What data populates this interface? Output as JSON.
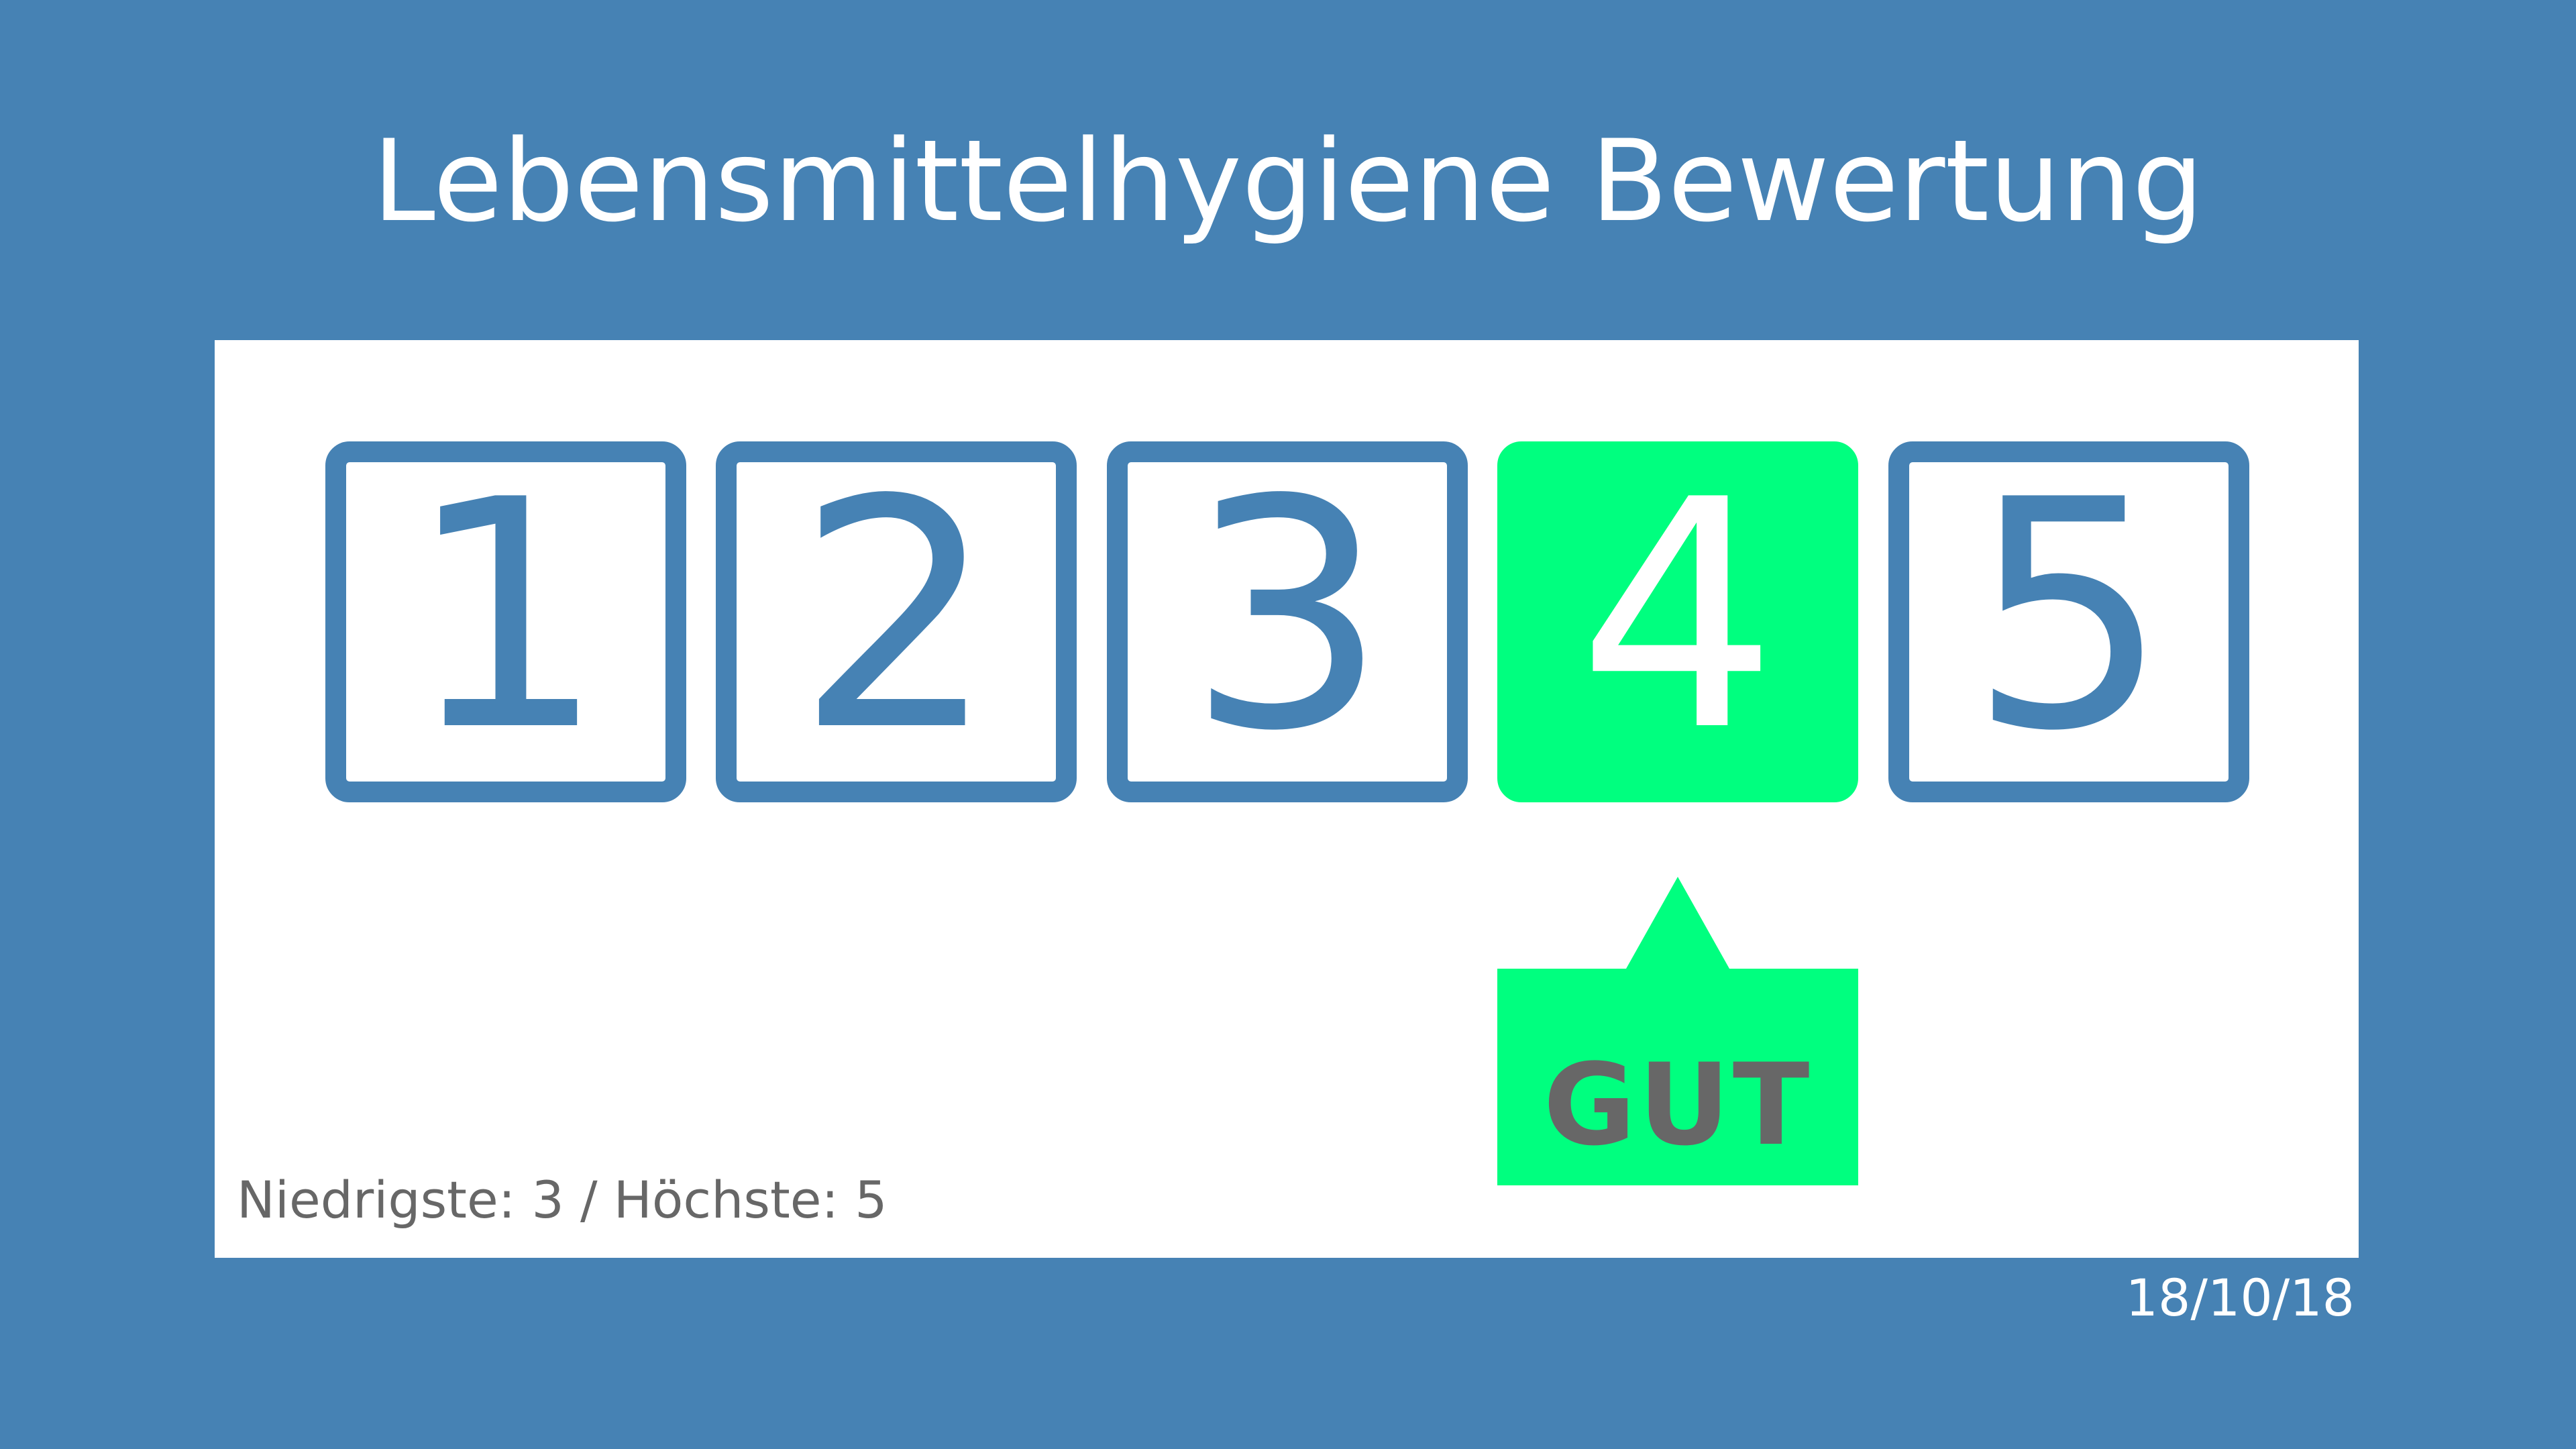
{
  "title": "Lebensmittelhygiene Bewertung",
  "ratings": [
    {
      "label": "1",
      "selected": false
    },
    {
      "label": "2",
      "selected": false
    },
    {
      "label": "3",
      "selected": false
    },
    {
      "label": "4",
      "selected": true
    },
    {
      "label": "5",
      "selected": false
    }
  ],
  "selected_rating": 4,
  "result_label": "GUT",
  "range_text": "Niedrigste: 3 / Höchste: 5",
  "date": "18/10/18",
  "colors": {
    "background": "#4682b4",
    "panel": "#ffffff",
    "box_border": "#4682b4",
    "selected": "#00ff7f",
    "label_text": "#676767"
  }
}
